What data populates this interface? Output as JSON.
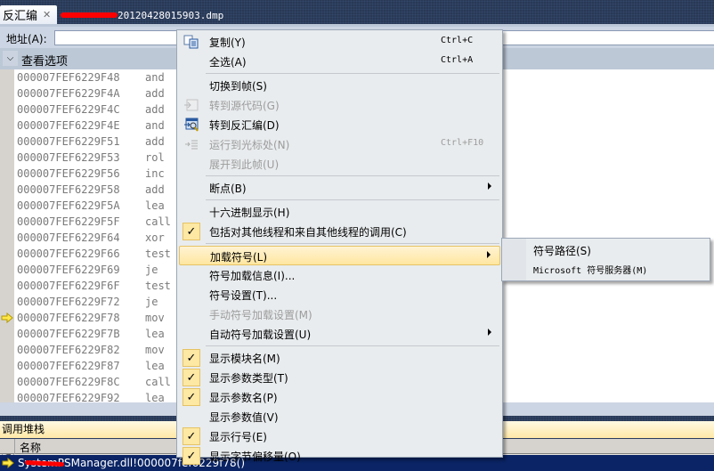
{
  "tabs": [
    {
      "label": "反汇编",
      "active": true,
      "close_glyph": "✕"
    },
    {
      "label_suffix": "20120428015903.dmp",
      "active": false,
      "redacted_prefix": true
    }
  ],
  "address_bar": {
    "label": "地址(A):",
    "value": ""
  },
  "view_options": {
    "label": "查看选项",
    "expanded": true
  },
  "disassembly": {
    "current_line_index": 15,
    "lines": [
      {
        "address": "000007FEF6229F48",
        "op": "and"
      },
      {
        "address": "000007FEF6229F4A",
        "op": "add"
      },
      {
        "address": "000007FEF6229F4C",
        "op": "add"
      },
      {
        "address": "000007FEF6229F4E",
        "op": "and"
      },
      {
        "address": "000007FEF6229F51",
        "op": "add"
      },
      {
        "address": "000007FEF6229F53",
        "op": "rol"
      },
      {
        "address": "000007FEF6229F56",
        "op": "inc"
      },
      {
        "address": "000007FEF6229F58",
        "op": "add"
      },
      {
        "address": "000007FEF6229F5A",
        "op": "lea"
      },
      {
        "address": "000007FEF6229F5F",
        "op": "call"
      },
      {
        "address": "000007FEF6229F64",
        "op": "xor"
      },
      {
        "address": "000007FEF6229F66",
        "op": "test"
      },
      {
        "address": "000007FEF6229F69",
        "op": "je"
      },
      {
        "address": "000007FEF6229F6F",
        "op": "test"
      },
      {
        "address": "000007FEF6229F72",
        "op": "je"
      },
      {
        "address": "000007FEF6229F78",
        "op": "mov"
      },
      {
        "address": "000007FEF6229F7B",
        "op": "lea"
      },
      {
        "address": "000007FEF6229F82",
        "op": "mov"
      },
      {
        "address": "000007FEF6229F87",
        "op": "lea"
      },
      {
        "address": "000007FEF6229F8C",
        "op": "call"
      },
      {
        "address": "000007FEF6229F92",
        "op": "lea"
      }
    ]
  },
  "call_stack": {
    "title": "调用堆栈",
    "column_name": "名称",
    "rows": [
      {
        "text": "SystemPSManager.dll!000007fef6229f78()",
        "current": true,
        "partially_redacted": true
      }
    ]
  },
  "context_menu": {
    "items": [
      {
        "label": "复制(Y)",
        "shortcut": "Ctrl+C",
        "icon": "copy-icon",
        "enabled": true
      },
      {
        "label": "全选(A)",
        "shortcut": "Ctrl+A",
        "enabled": true
      },
      {
        "separator": true
      },
      {
        "label": "切换到帧(S)",
        "enabled": true
      },
      {
        "label": "转到源代码(G)",
        "icon": "goto-source-icon",
        "enabled": false
      },
      {
        "label": "转到反汇编(D)",
        "icon": "goto-disassembly-icon",
        "enabled": true
      },
      {
        "label": "运行到光标处(N)",
        "shortcut": "Ctrl+F10",
        "icon": "run-to-cursor-icon",
        "enabled": false
      },
      {
        "label": "展开到此帧(U)",
        "enabled": false
      },
      {
        "separator": true
      },
      {
        "label": "断点(B)",
        "submenu": true,
        "enabled": true
      },
      {
        "separator": true
      },
      {
        "label": "十六进制显示(H)",
        "enabled": true
      },
      {
        "label": "包括对其他线程和来自其他线程的调用(C)",
        "checked": true,
        "enabled": true
      },
      {
        "separator": true
      },
      {
        "label": "加载符号(L)",
        "submenu": true,
        "highlighted": true,
        "enabled": true
      },
      {
        "label": "符号加载信息(I)...",
        "enabled": true
      },
      {
        "label": "符号设置(T)...",
        "enabled": true
      },
      {
        "label": "手动符号加载设置(M)",
        "enabled": false
      },
      {
        "label": "自动符号加载设置(U)",
        "submenu": true,
        "enabled": true
      },
      {
        "separator": true
      },
      {
        "label": "显示模块名(M)",
        "checked": true,
        "enabled": true
      },
      {
        "label": "显示参数类型(T)",
        "checked": true,
        "enabled": true
      },
      {
        "label": "显示参数名(P)",
        "checked": true,
        "enabled": true
      },
      {
        "label": "显示参数值(V)",
        "checked": false,
        "enabled": true
      },
      {
        "label": "显示行号(E)",
        "checked": true,
        "enabled": true
      },
      {
        "label": "显示字节偏移量(O)",
        "checked": true,
        "enabled": true
      }
    ]
  },
  "submenu_load_symbols": {
    "items": [
      {
        "label": "符号路径(S)"
      },
      {
        "label": "Microsoft 符号服务器(M)"
      }
    ]
  },
  "colors": {
    "menu_highlight": "#ffe6a0",
    "checkbox_bg": "#fde8a4",
    "selection_row": "#0a2465",
    "tabstrip": "#293955",
    "redaction": "#ff0000"
  }
}
